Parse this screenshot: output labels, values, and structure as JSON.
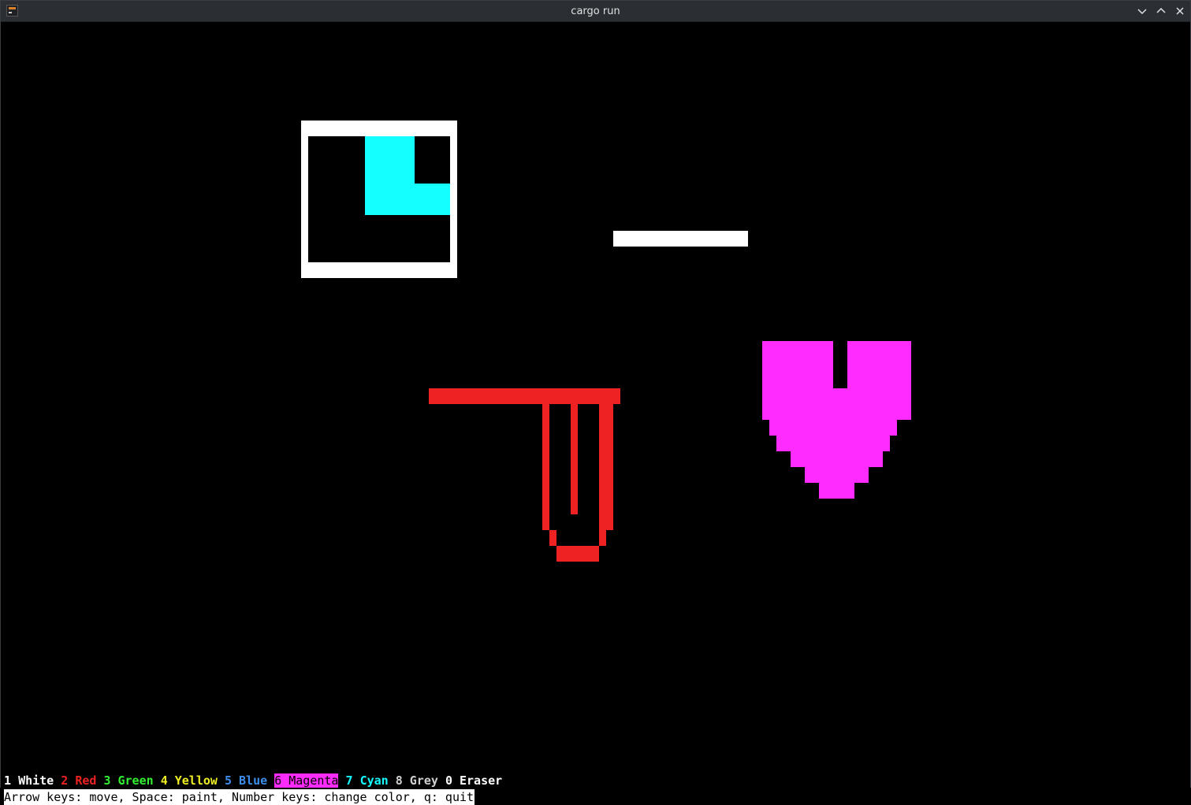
{
  "window": {
    "title": "cargo run"
  },
  "palette": [
    {
      "key": "1",
      "label": "White",
      "color": "#ffffff",
      "selected": false
    },
    {
      "key": "2",
      "label": "Red",
      "color": "#ee2222",
      "selected": false
    },
    {
      "key": "3",
      "label": "Green",
      "color": "#33ee33",
      "selected": false
    },
    {
      "key": "4",
      "label": "Yellow",
      "color": "#eeee22",
      "selected": false
    },
    {
      "key": "5",
      "label": "Blue",
      "color": "#3b8eea",
      "selected": false
    },
    {
      "key": "6",
      "label": "Magenta",
      "color": "#ff2bff",
      "selected": true
    },
    {
      "key": "7",
      "label": "Cyan",
      "color": "#14ffff",
      "selected": false
    },
    {
      "key": "8",
      "label": "Grey",
      "color": "#d0d0d0",
      "selected": false
    },
    {
      "key": "0",
      "label": "Eraser",
      "color": "#ffffff",
      "selected": false
    }
  ],
  "hint": "Arrow keys: move, Space: paint, Number keys: change color, q: quit",
  "icons": {
    "app": "terminal-icon",
    "minimize": "chevron-down-icon",
    "maximize": "chevron-up-icon",
    "close": "close-icon"
  }
}
